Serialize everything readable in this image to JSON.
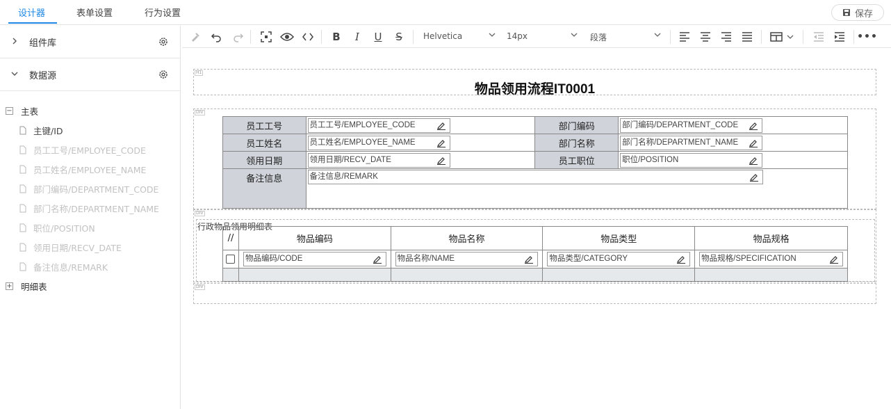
{
  "tabs": [
    {
      "label": "设计器"
    },
    {
      "label": "表单设置"
    },
    {
      "label": "行为设置"
    }
  ],
  "save_label": "保存",
  "left_panel": {
    "component_lib": "组件库",
    "datasource": "数据源",
    "main_table": "主表",
    "main_fields": [
      "主键/ID",
      "员工工号/EMPLOYEE_CODE",
      "员工姓名/EMPLOYEE_NAME",
      "部门编码/DEPARTMENT_CODE",
      "部门名称/DEPARTMENT_NAME",
      "职位/POSITION",
      "领用日期/RECV_DATE",
      "备注信息/REMARK"
    ],
    "detail_table": "明细表"
  },
  "toolbar": {
    "font": "Helvetica",
    "size": "14px",
    "block": "段落"
  },
  "canvas": {
    "title": "物品领用流程IT0001",
    "tag_h1": "H1",
    "tag_div": "DIV",
    "rows": [
      {
        "label1": "员工工号",
        "field1": "员工工号/EMPLOYEE_CODE",
        "label2": "部门编码",
        "field2": "部门编码/DEPARTMENT_CODE"
      },
      {
        "label1": "员工姓名",
        "field1": "员工姓名/EMPLOYEE_NAME",
        "label2": "部门名称",
        "field2": "部门名称/DEPARTMENT_NAME"
      },
      {
        "label1": "领用日期",
        "field1": "领用日期/RECV_DATE",
        "label2": "员工职位",
        "field2": "职位/POSITION"
      }
    ],
    "remark_label": "备注信息",
    "remark_field": "备注信息/REMARK",
    "detail_title": "行政物品领用明细表",
    "detail_headers": [
      "//",
      "物品编码",
      "物品名称",
      "物品类型",
      "物品规格"
    ],
    "detail_fields": [
      "物品编码/CODE",
      "物品名称/NAME",
      "物品类型/CATEGORY",
      "物品规格/SPECIFICATION"
    ]
  },
  "colors": {
    "accent": "#1e88e5",
    "label_bg": "#d0d4da"
  }
}
